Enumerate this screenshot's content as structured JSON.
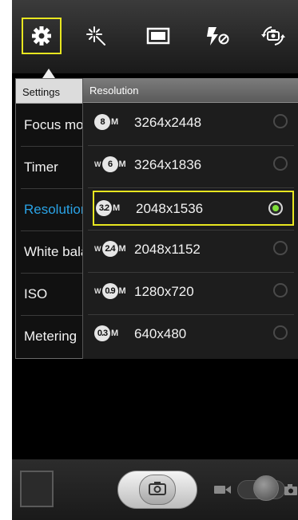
{
  "colors": {
    "highlight": "#e8e620",
    "active_setting": "#2aa3e6",
    "radio_selected": "#7fe03a"
  },
  "toolbar": {
    "items": [
      {
        "name": "settings",
        "icon": "gear-icon",
        "selected": true
      },
      {
        "name": "effects",
        "icon": "sparkle-icon",
        "selected": false
      },
      {
        "name": "screen",
        "icon": "rectangle-icon",
        "selected": false
      },
      {
        "name": "flash",
        "icon": "flash-off-icon",
        "selected": false
      },
      {
        "name": "switch-camera",
        "icon": "camera-switch-icon",
        "selected": false
      }
    ]
  },
  "settings": {
    "title": "Settings",
    "items": [
      {
        "label": "Focus mode",
        "active": false
      },
      {
        "label": "Timer",
        "active": false
      },
      {
        "label": "Resolution",
        "active": true
      },
      {
        "label": "White balance",
        "active": false
      },
      {
        "label": "ISO",
        "active": false
      },
      {
        "label": "Metering",
        "active": false
      }
    ]
  },
  "resolution": {
    "title": "Resolution",
    "options": [
      {
        "megapixels": "8",
        "wide": false,
        "value": "3264x2448",
        "selected": false
      },
      {
        "megapixels": "6",
        "wide": true,
        "value": "3264x1836",
        "selected": false
      },
      {
        "megapixels": "3.2",
        "wide": false,
        "value": "2048x1536",
        "selected": true
      },
      {
        "megapixels": "2.4",
        "wide": true,
        "value": "2048x1152",
        "selected": false
      },
      {
        "megapixels": "0.9",
        "wide": true,
        "value": "1280x720",
        "selected": false
      },
      {
        "megapixels": "0.3",
        "wide": false,
        "value": "640x480",
        "selected": false
      }
    ],
    "mp_suffix": "M",
    "wide_prefix": "W"
  },
  "bottom": {
    "thumbnail": "gallery-thumbnail",
    "shutter_icon": "camera-icon",
    "mode_icons": [
      "video-camera-icon",
      "camera-icon"
    ],
    "mode": "camera"
  }
}
